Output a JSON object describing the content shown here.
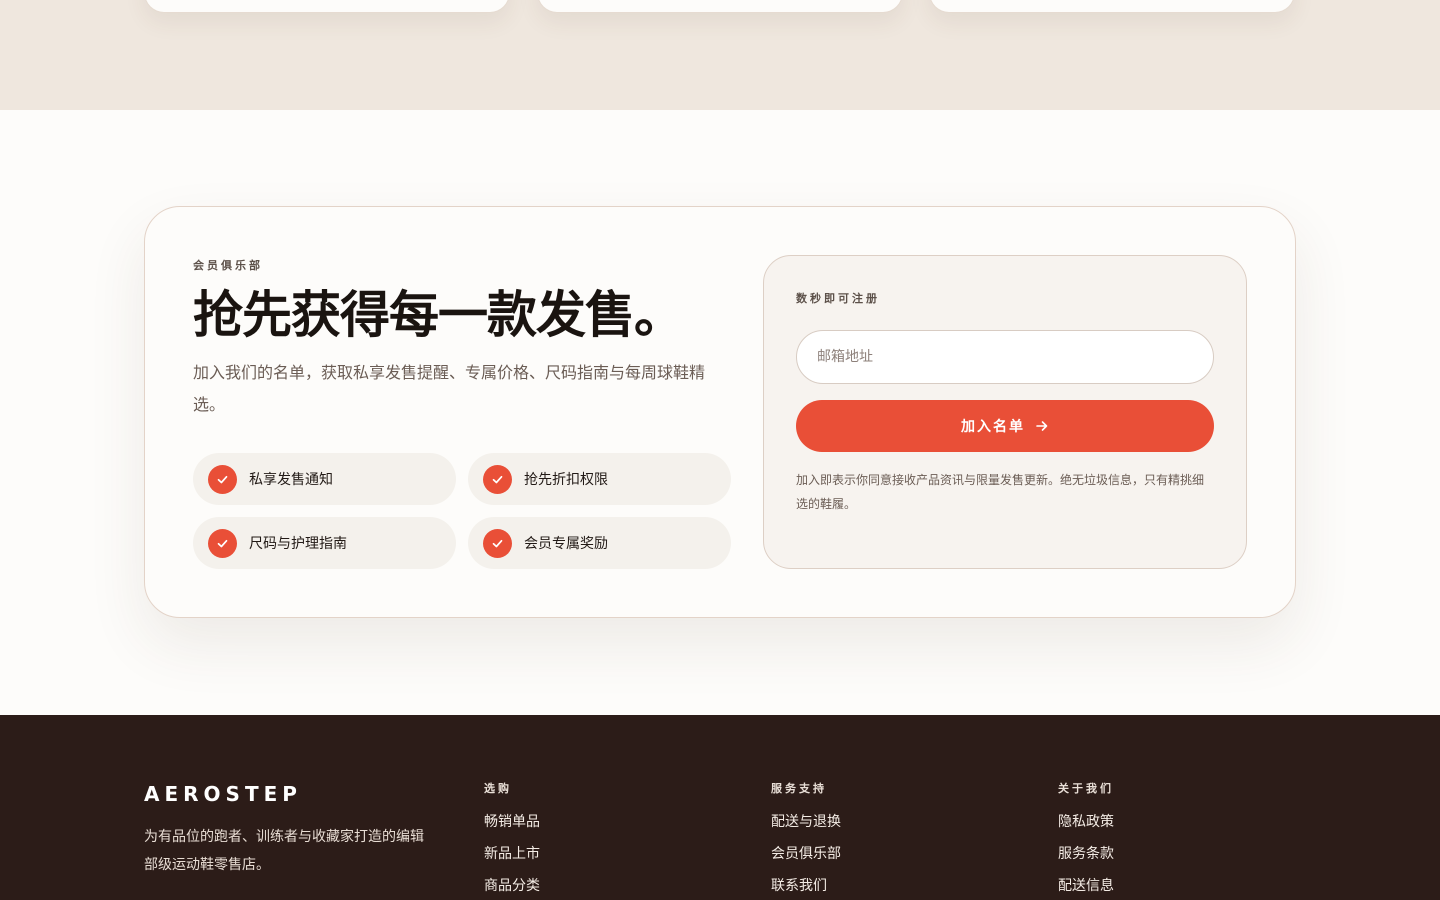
{
  "club": {
    "eyebrow": "会员俱乐部",
    "headline": "抢先获得每一款发售。",
    "description": "加入我们的名单，获取私享发售提醒、专属价格、尺码指南与每周球鞋精选。",
    "benefits": [
      {
        "label": "私享发售通知"
      },
      {
        "label": "抢先折扣权限"
      },
      {
        "label": "尺码与护理指南"
      },
      {
        "label": "会员专属奖励"
      }
    ]
  },
  "form": {
    "eyebrow": "数秒即可注册",
    "email_placeholder": "邮箱地址",
    "submit_label": "加入名单",
    "note": "加入即表示你同意接收产品资讯与限量发售更新。绝无垃圾信息，只有精挑细选的鞋履。"
  },
  "footer": {
    "brand": "AEROSTEP",
    "tagline": "为有品位的跑者、训练者与收藏家打造的编辑部级运动鞋零售店。",
    "columns": [
      {
        "title": "选购",
        "links": [
          "畅销单品",
          "新品上市",
          "商品分类"
        ]
      },
      {
        "title": "服务支持",
        "links": [
          "配送与退换",
          "会员俱乐部",
          "联系我们"
        ]
      },
      {
        "title": "关于我们",
        "links": [
          "隐私政策",
          "服务条款",
          "配送信息"
        ]
      }
    ]
  },
  "colors": {
    "accent": "#e94f37",
    "footer_bg": "#2c1c18",
    "band_bg": "#efe7de"
  },
  "icons": {
    "benefit": "check-icon",
    "submit": "arrow-right-icon"
  }
}
